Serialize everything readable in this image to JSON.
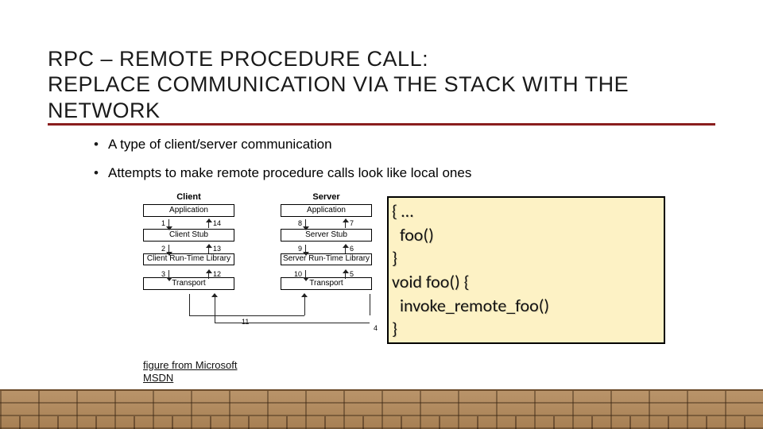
{
  "title": "RPC – REMOTE PROCEDURE CALL:\nREPLACE COMMUNICATION VIA THE STACK WITH THE NETWORK",
  "bullets": {
    "b1": "A type of client/server communication",
    "b2": "Attempts to make remote procedure calls look like local ones"
  },
  "diagram": {
    "client_header": "Client",
    "server_header": "Server",
    "layers": {
      "app": "Application",
      "cstub": "Client Stub",
      "sstub": "Server Stub",
      "crt": "Client Run-Time Library",
      "srt": "Server Run-Time Library",
      "transport": "Transport"
    },
    "nums": {
      "c1l": "1",
      "c1r": "14",
      "c2l": "2",
      "c2r": "13",
      "c3l": "3",
      "c3r": "12",
      "s1l": "8",
      "s1r": "7",
      "s2l": "9",
      "s2r": "6",
      "s3l": "10",
      "s3r": "5",
      "big_left": "11",
      "big_right": "4"
    }
  },
  "code": "{ …\n  foo()\n}\nvoid foo() {\n  invoke_remote_foo()\n}",
  "caption": "figure from Microsoft MSDN"
}
